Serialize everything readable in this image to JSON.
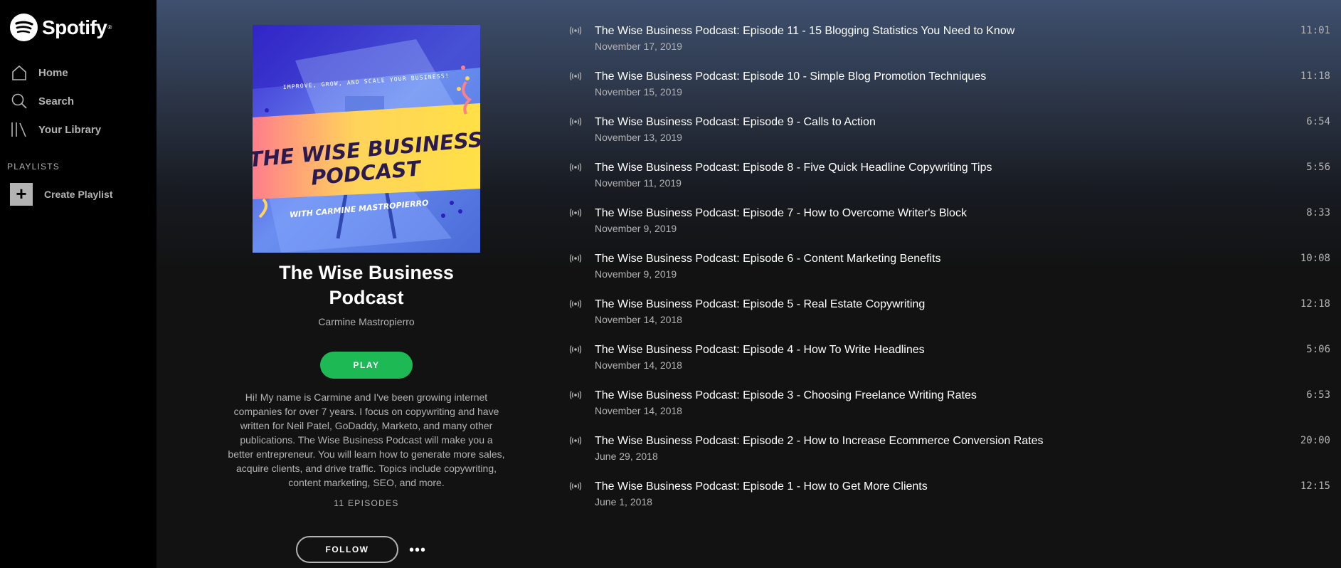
{
  "app": {
    "name": "Spotify"
  },
  "sidebar": {
    "nav": [
      {
        "label": "Home",
        "icon": "home-icon"
      },
      {
        "label": "Search",
        "icon": "search-icon"
      },
      {
        "label": "Your Library",
        "icon": "library-icon"
      }
    ],
    "playlists_heading": "PLAYLISTS",
    "create_playlist_label": "Create Playlist"
  },
  "podcast": {
    "cover": {
      "tagline": "IMPROVE, GROW, AND SCALE YOUR BUSINESS!",
      "title_line1": "THE WISE BUSINESS",
      "title_line2": "PODCAST",
      "byline": "WITH CARMINE MASTROPIERRO"
    },
    "title": "The Wise Business Podcast",
    "author": "Carmine Mastropierro",
    "play_label": "PLAY",
    "description": "Hi! My name is Carmine and I've been growing internet companies for over 7 years. I focus on copywriting and have written for Neil Patel, GoDaddy, Marketo, and many other publications. The Wise Business Podcast will make you a better entrepreneur. You will learn how to generate more sales, acquire clients, and drive traffic. Topics include copywriting, content marketing, SEO, and more.",
    "episode_count": "11 EPISODES",
    "follow_label": "FOLLOW",
    "more_label": "•••"
  },
  "episodes": [
    {
      "title": "The Wise Business Podcast: Episode 11 - 15 Blogging Statistics You Need to Know",
      "date": "November 17, 2019",
      "duration": "11:01"
    },
    {
      "title": "The Wise Business Podcast: Episode 10 - Simple Blog Promotion Techniques",
      "date": "November 15, 2019",
      "duration": "11:18"
    },
    {
      "title": "The Wise Business Podcast: Episode 9 - Calls to Action",
      "date": "November 13, 2019",
      "duration": "6:54"
    },
    {
      "title": "The Wise Business Podcast: Episode 8 - Five Quick Headline Copywriting Tips",
      "date": "November 11, 2019",
      "duration": "5:56"
    },
    {
      "title": "The Wise Business Podcast: Episode 7 - How to Overcome Writer's Block",
      "date": "November 9, 2019",
      "duration": "8:33"
    },
    {
      "title": "The Wise Business Podcast: Episode 6 - Content Marketing Benefits",
      "date": "November 9, 2019",
      "duration": "10:08"
    },
    {
      "title": "The Wise Business Podcast: Episode 5 - Real Estate Copywriting",
      "date": "November 14, 2018",
      "duration": "12:18"
    },
    {
      "title": "The Wise Business Podcast: Episode 4 - How To Write Headlines",
      "date": "November 14, 2018",
      "duration": "5:06"
    },
    {
      "title": "The Wise Business Podcast: Episode 3 - Choosing Freelance Writing Rates",
      "date": "November 14, 2018",
      "duration": "6:53"
    },
    {
      "title": "The Wise Business Podcast: Episode 2 - How to Increase Ecommerce Conversion Rates",
      "date": "June 29, 2018",
      "duration": "20:00"
    },
    {
      "title": "The Wise Business Podcast: Episode 1 - How to Get More Clients",
      "date": "June 1, 2018",
      "duration": "12:15"
    }
  ],
  "colors": {
    "accent": "#1db954",
    "sidebar_bg": "#000000",
    "main_bg": "#121212",
    "header_gradient_top": "#3e506e"
  }
}
